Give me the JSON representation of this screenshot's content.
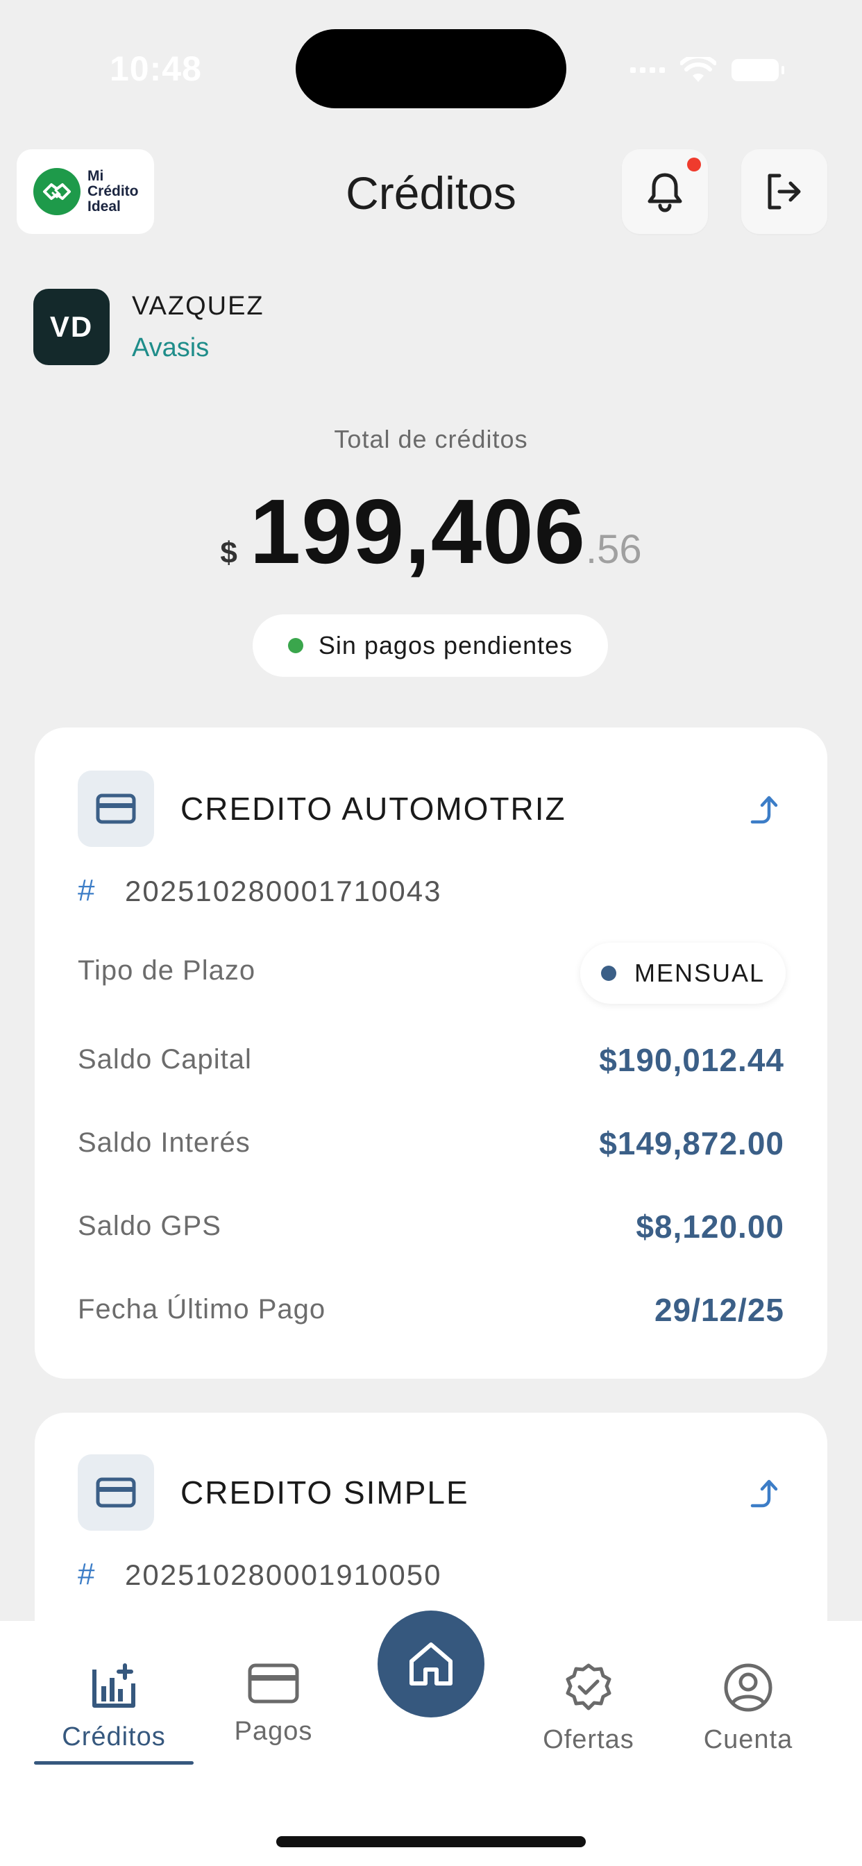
{
  "status_bar": {
    "time": "10:48"
  },
  "header": {
    "logo_lines": [
      "Mi",
      "Crédito",
      "Ideal"
    ],
    "title": "Créditos"
  },
  "user": {
    "initials": "VD",
    "name": "VAZQUEZ",
    "company": "Avasis"
  },
  "summary": {
    "label": "Total de créditos",
    "currency": "$",
    "amount_int": "199,406",
    "amount_dec": ".56",
    "status": "Sin pagos pendientes"
  },
  "credits": [
    {
      "title": "CREDITO AUTOMOTRIZ",
      "hash": "#",
      "number": "20251028000171004​3",
      "plazo_label": "Tipo de Plazo",
      "plazo_value": "MENSUAL",
      "rows": [
        {
          "label": "Saldo Capital",
          "value": "$190,012.44"
        },
        {
          "label": "Saldo Interés",
          "value": "$149,872.00"
        },
        {
          "label": "Saldo GPS",
          "value": "$8,120.00"
        },
        {
          "label": "Fecha Último Pago",
          "value": "29/12/25"
        }
      ]
    },
    {
      "title": "CREDITO SIMPLE",
      "hash": "#",
      "number": "202510280001910050"
    }
  ],
  "nav": {
    "creditos": "Créditos",
    "pagos": "Pagos",
    "ofertas": "Ofertas",
    "cuenta": "Cuenta"
  },
  "colors": {
    "primary": "#36587e",
    "accent": "#1f8d8a",
    "success": "#3aa64c",
    "alert": "#ef3b2d"
  }
}
